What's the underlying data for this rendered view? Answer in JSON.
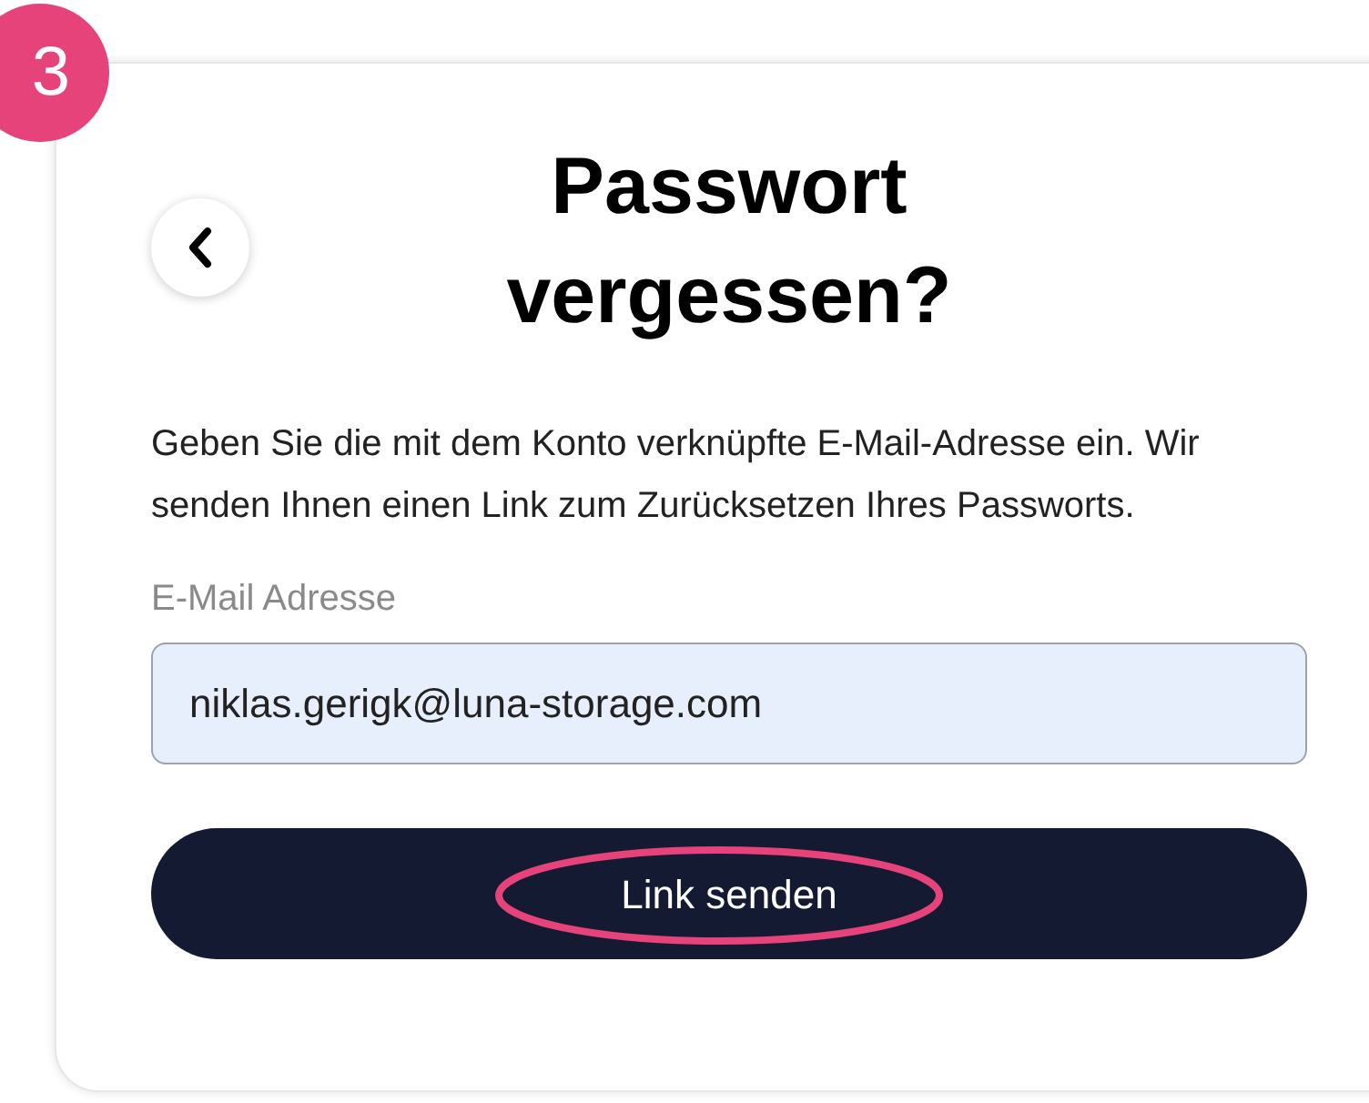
{
  "step_badge": "3",
  "title": "Passwort vergessen?",
  "description": "Geben Sie die mit dem Konto verknüpfte E-Mail-Adresse ein. Wir senden Ihnen einen Link zum Zurücksetzen Ihres Passworts.",
  "email_field": {
    "label": "E-Mail Adresse",
    "value": "niklas.gerigk@luna-storage.com"
  },
  "submit_button": {
    "label": "Link senden",
    "highlighted": true
  }
}
